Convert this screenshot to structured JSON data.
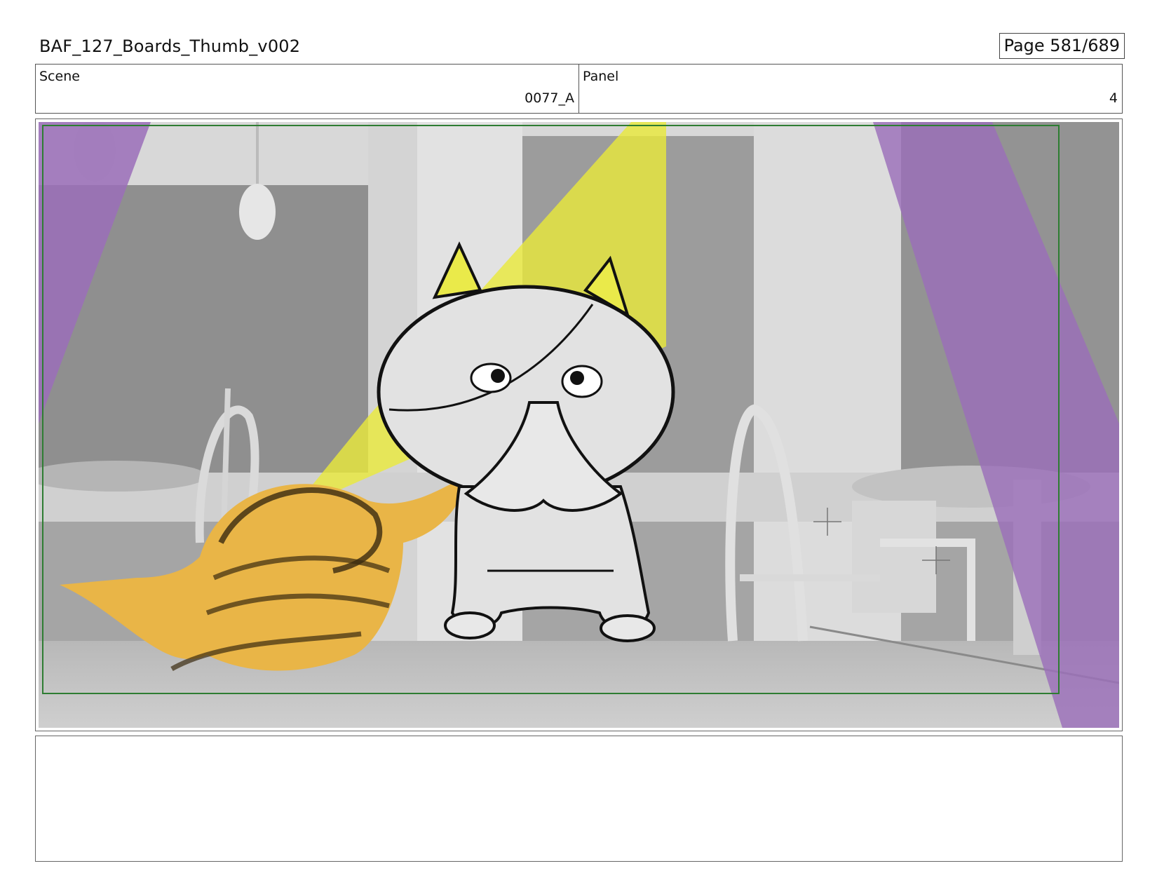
{
  "header": {
    "title": "BAF_127_Boards_Thumb_v002",
    "page": "Page 581/689"
  },
  "info": {
    "scene_label": "Scene",
    "scene_value": "0077_A",
    "panel_label": "Panel",
    "panel_value": "4"
  },
  "panel_image": {
    "description_icon": "storyboard-sketch-icon",
    "colors": {
      "background_gray": "#9a9a9a",
      "wall_light": "#d9d9d9",
      "spotlight_yellow": "#e6e640",
      "spotlight_purple": "#9b72b8",
      "character_fill": "#e4e4e4",
      "blob_orange": "#e8b84a",
      "safe_frame": "#2e7d32"
    }
  },
  "notes": {
    "text": ""
  }
}
